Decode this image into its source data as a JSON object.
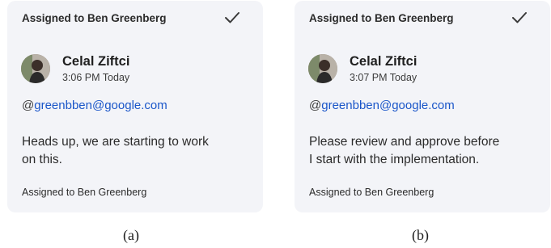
{
  "cards": [
    {
      "header": "Assigned to Ben Greenberg",
      "author": "Celal Ziftci",
      "time": "3:06 PM Today",
      "mention_prefix": "@",
      "mention_email": "greenbben@google.com",
      "message_line1": "Heads up, we are starting to work",
      "message_line2": "on this.",
      "footer": "Assigned to Ben Greenberg",
      "caption": "(a)"
    },
    {
      "header": "Assigned to Ben Greenberg",
      "author": "Celal Ziftci",
      "time": "3:07 PM Today",
      "mention_prefix": "@",
      "mention_email": "greenbben@google.com",
      "message_line1": "Please review and approve before",
      "message_line2": "I start with the implementation.",
      "footer": "Assigned to Ben Greenberg",
      "caption": "(b)"
    }
  ],
  "icons": {
    "check": "check-icon",
    "avatar": "avatar"
  },
  "colors": {
    "card_bg": "#f3f4f8",
    "mention": "#1a56c9"
  }
}
